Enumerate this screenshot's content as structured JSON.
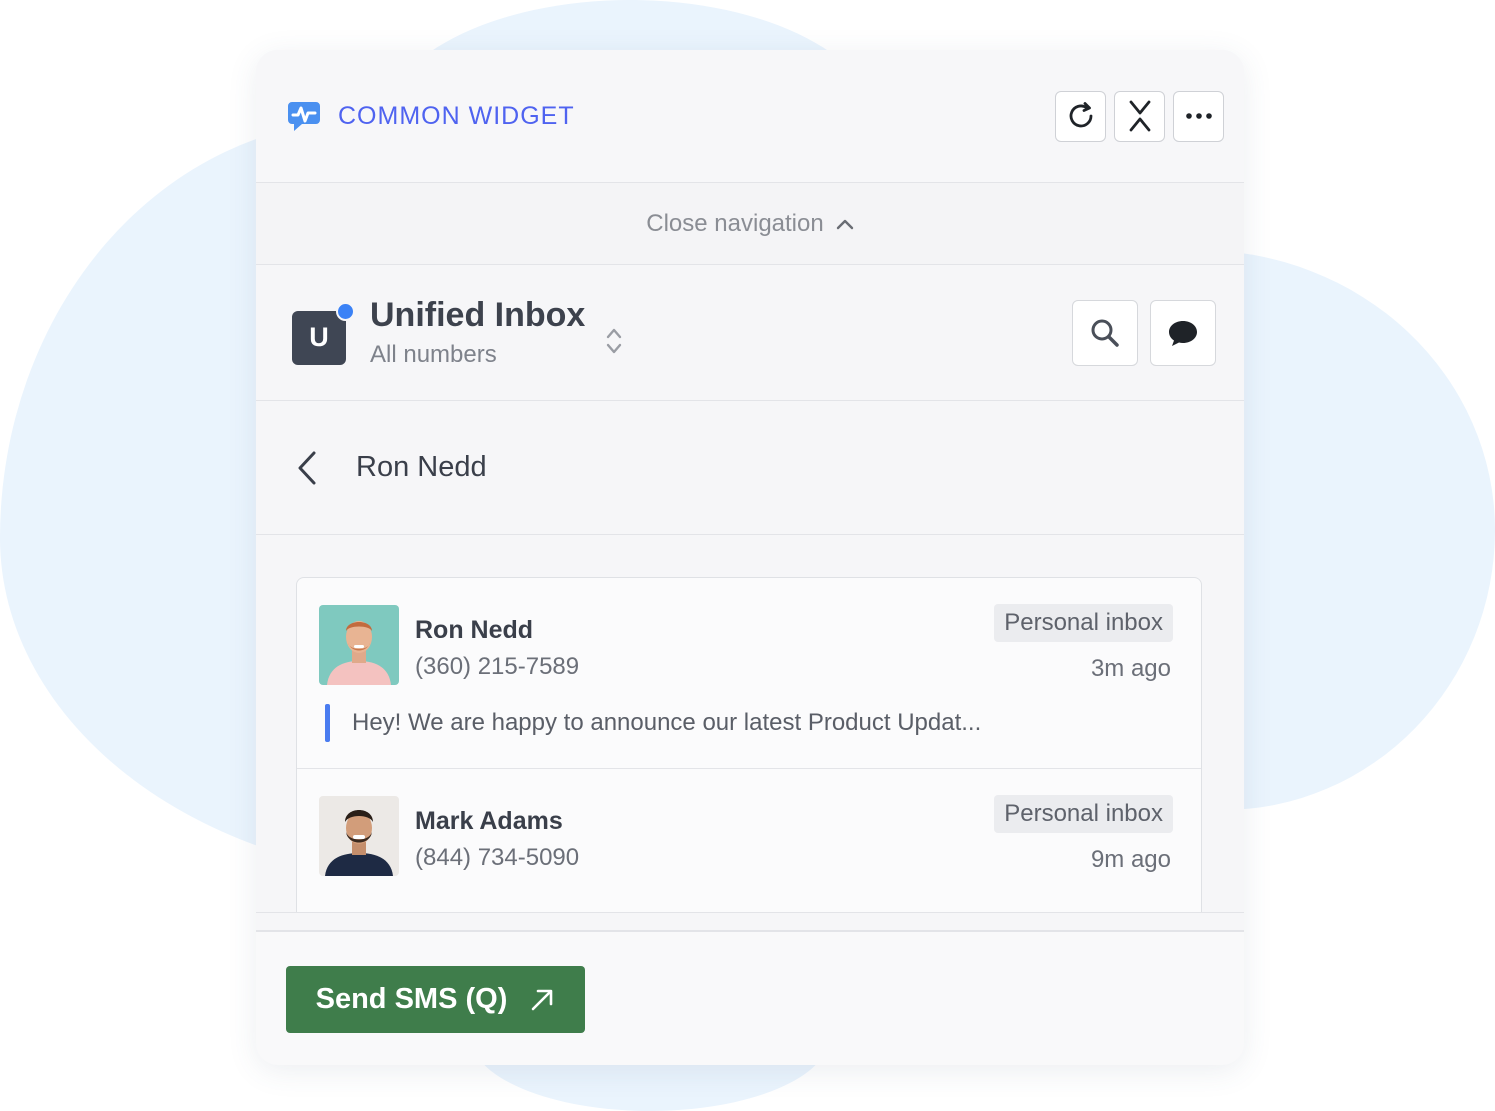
{
  "widget": {
    "title": "COMMON WIDGET",
    "brand_color": "#4f63f0",
    "header_actions": [
      {
        "icon": "refresh-icon"
      },
      {
        "icon": "collapse-icon"
      },
      {
        "icon": "more-icon"
      }
    ]
  },
  "navigation": {
    "close_label": "Close navigation",
    "icon": "chevron-up-icon"
  },
  "inbox": {
    "badge_letter": "U",
    "title": "Unified Inbox",
    "subtitle": "All numbers",
    "notification_dot_color": "#3b82f6",
    "actions": [
      {
        "icon": "search-icon"
      },
      {
        "icon": "chat-icon"
      }
    ]
  },
  "contact": {
    "name": "Ron Nedd",
    "back_icon": "chevron-left-icon"
  },
  "conversations": [
    {
      "name": "Ron Nedd",
      "phone": "(360) 215-7589",
      "tag": "Personal inbox",
      "time": "3m ago",
      "preview": "Hey! We are happy to announce our latest Product Updat..."
    },
    {
      "name": "Mark Adams",
      "phone": "(844) 734-5090",
      "tag": "Personal inbox",
      "time": "9m ago"
    }
  ],
  "footer": {
    "send_label": "Send SMS (Q)",
    "send_color": "#3f7d4b",
    "send_icon": "arrow-up-right-icon"
  }
}
